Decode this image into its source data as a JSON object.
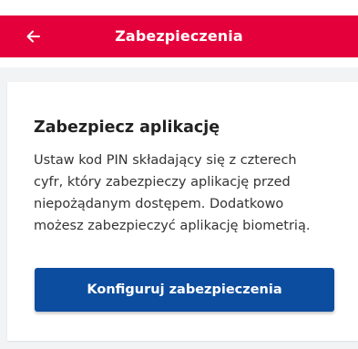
{
  "header": {
    "title": "Zabezpieczenia",
    "back_icon": "arrow-left-icon",
    "background_color": "#e4003a"
  },
  "card": {
    "title": "Zabezpiecz aplikację",
    "description_lines": [
      "Ustaw kod PIN składający się z czterech",
      "cyfr, który zabezpieczy aplikację przed",
      "niepożądanym dostępem. Dodatkowo",
      "możesz zabezpieczyć aplikację biometrią."
    ],
    "button_label": "Konfiguruj zabezpieczenia",
    "button_color": "#0d4d9f"
  }
}
